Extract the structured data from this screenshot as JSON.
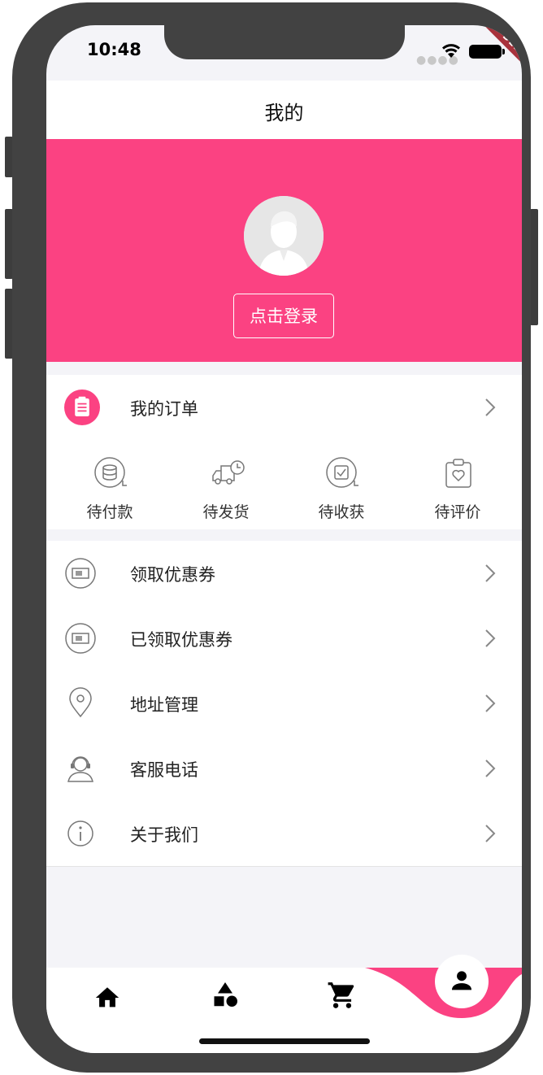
{
  "status_bar": {
    "time": "10:48",
    "debug": "DEBUG"
  },
  "header": {
    "title": "我的"
  },
  "profile": {
    "login_label": "点击登录"
  },
  "orders": {
    "label": "我的订单"
  },
  "order_status": [
    {
      "label": "待付款",
      "icon": "coins-icon"
    },
    {
      "label": "待发货",
      "icon": "truck-icon"
    },
    {
      "label": "待收获",
      "icon": "check-box-icon"
    },
    {
      "label": "待评价",
      "icon": "clipboard-heart-icon"
    }
  ],
  "menu": [
    {
      "label": "领取优惠券",
      "icon": "ticket-icon"
    },
    {
      "label": "已领取优惠券",
      "icon": "ticket-icon"
    },
    {
      "label": "地址管理",
      "icon": "location-pin-icon"
    },
    {
      "label": "客服电话",
      "icon": "customer-service-icon"
    },
    {
      "label": "关于我们",
      "icon": "info-icon"
    }
  ],
  "nav": [
    {
      "name": "home",
      "icon": "home-icon"
    },
    {
      "name": "category",
      "icon": "shapes-icon"
    },
    {
      "name": "cart",
      "icon": "cart-icon"
    },
    {
      "name": "profile",
      "icon": "person-icon",
      "active": true
    }
  ],
  "colors": {
    "accent": "#fb4282",
    "frame": "#424242",
    "background": "#f4f4f8"
  }
}
